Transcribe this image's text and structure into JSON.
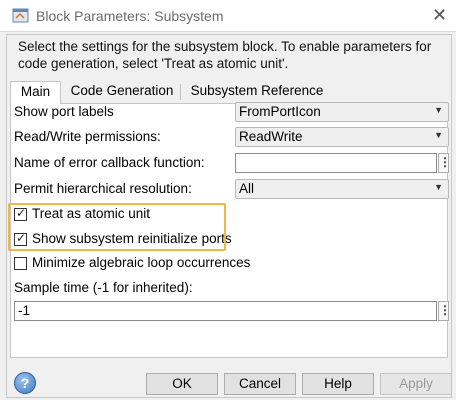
{
  "window": {
    "title": "Block Parameters: Subsystem",
    "close_glyph": "✕",
    "app_icon": "matlab-block-icon"
  },
  "description": "Select the settings for the subsystem block. To enable parameters for code generation, select 'Treat as atomic unit'.",
  "tabs": [
    {
      "label": "Main",
      "active": true
    },
    {
      "label": "Code Generation",
      "active": false
    },
    {
      "label": "Subsystem Reference",
      "active": false
    }
  ],
  "fields": {
    "show_port_labels": {
      "label": "Show port labels",
      "value": "FromPortIcon"
    },
    "rw_permissions": {
      "label": "Read/Write permissions:",
      "value": "ReadWrite"
    },
    "error_callback": {
      "label": "Name of error callback function:",
      "value": ""
    },
    "hier_resolution": {
      "label": "Permit hierarchical resolution:",
      "value": "All"
    },
    "sample_time": {
      "label": "Sample time (-1 for inherited):",
      "value": "-1"
    }
  },
  "checkboxes": {
    "atomic": {
      "label": "Treat as atomic unit",
      "checked": true
    },
    "reinit_ports": {
      "label": "Show subsystem reinitialize ports",
      "checked": true
    },
    "minimize_loops": {
      "label": "Minimize algebraic loop occurrences",
      "checked": false
    }
  },
  "check_glyph": "✓",
  "dropdown_arrow": "▼",
  "ellipsis_glyph": "⋮",
  "help_glyph": "?",
  "buttons": {
    "ok": "OK",
    "cancel": "Cancel",
    "help": "Help",
    "apply": "Apply"
  },
  "colors": {
    "highlight": "#f0b646",
    "help_icon": "#3d78bf"
  }
}
